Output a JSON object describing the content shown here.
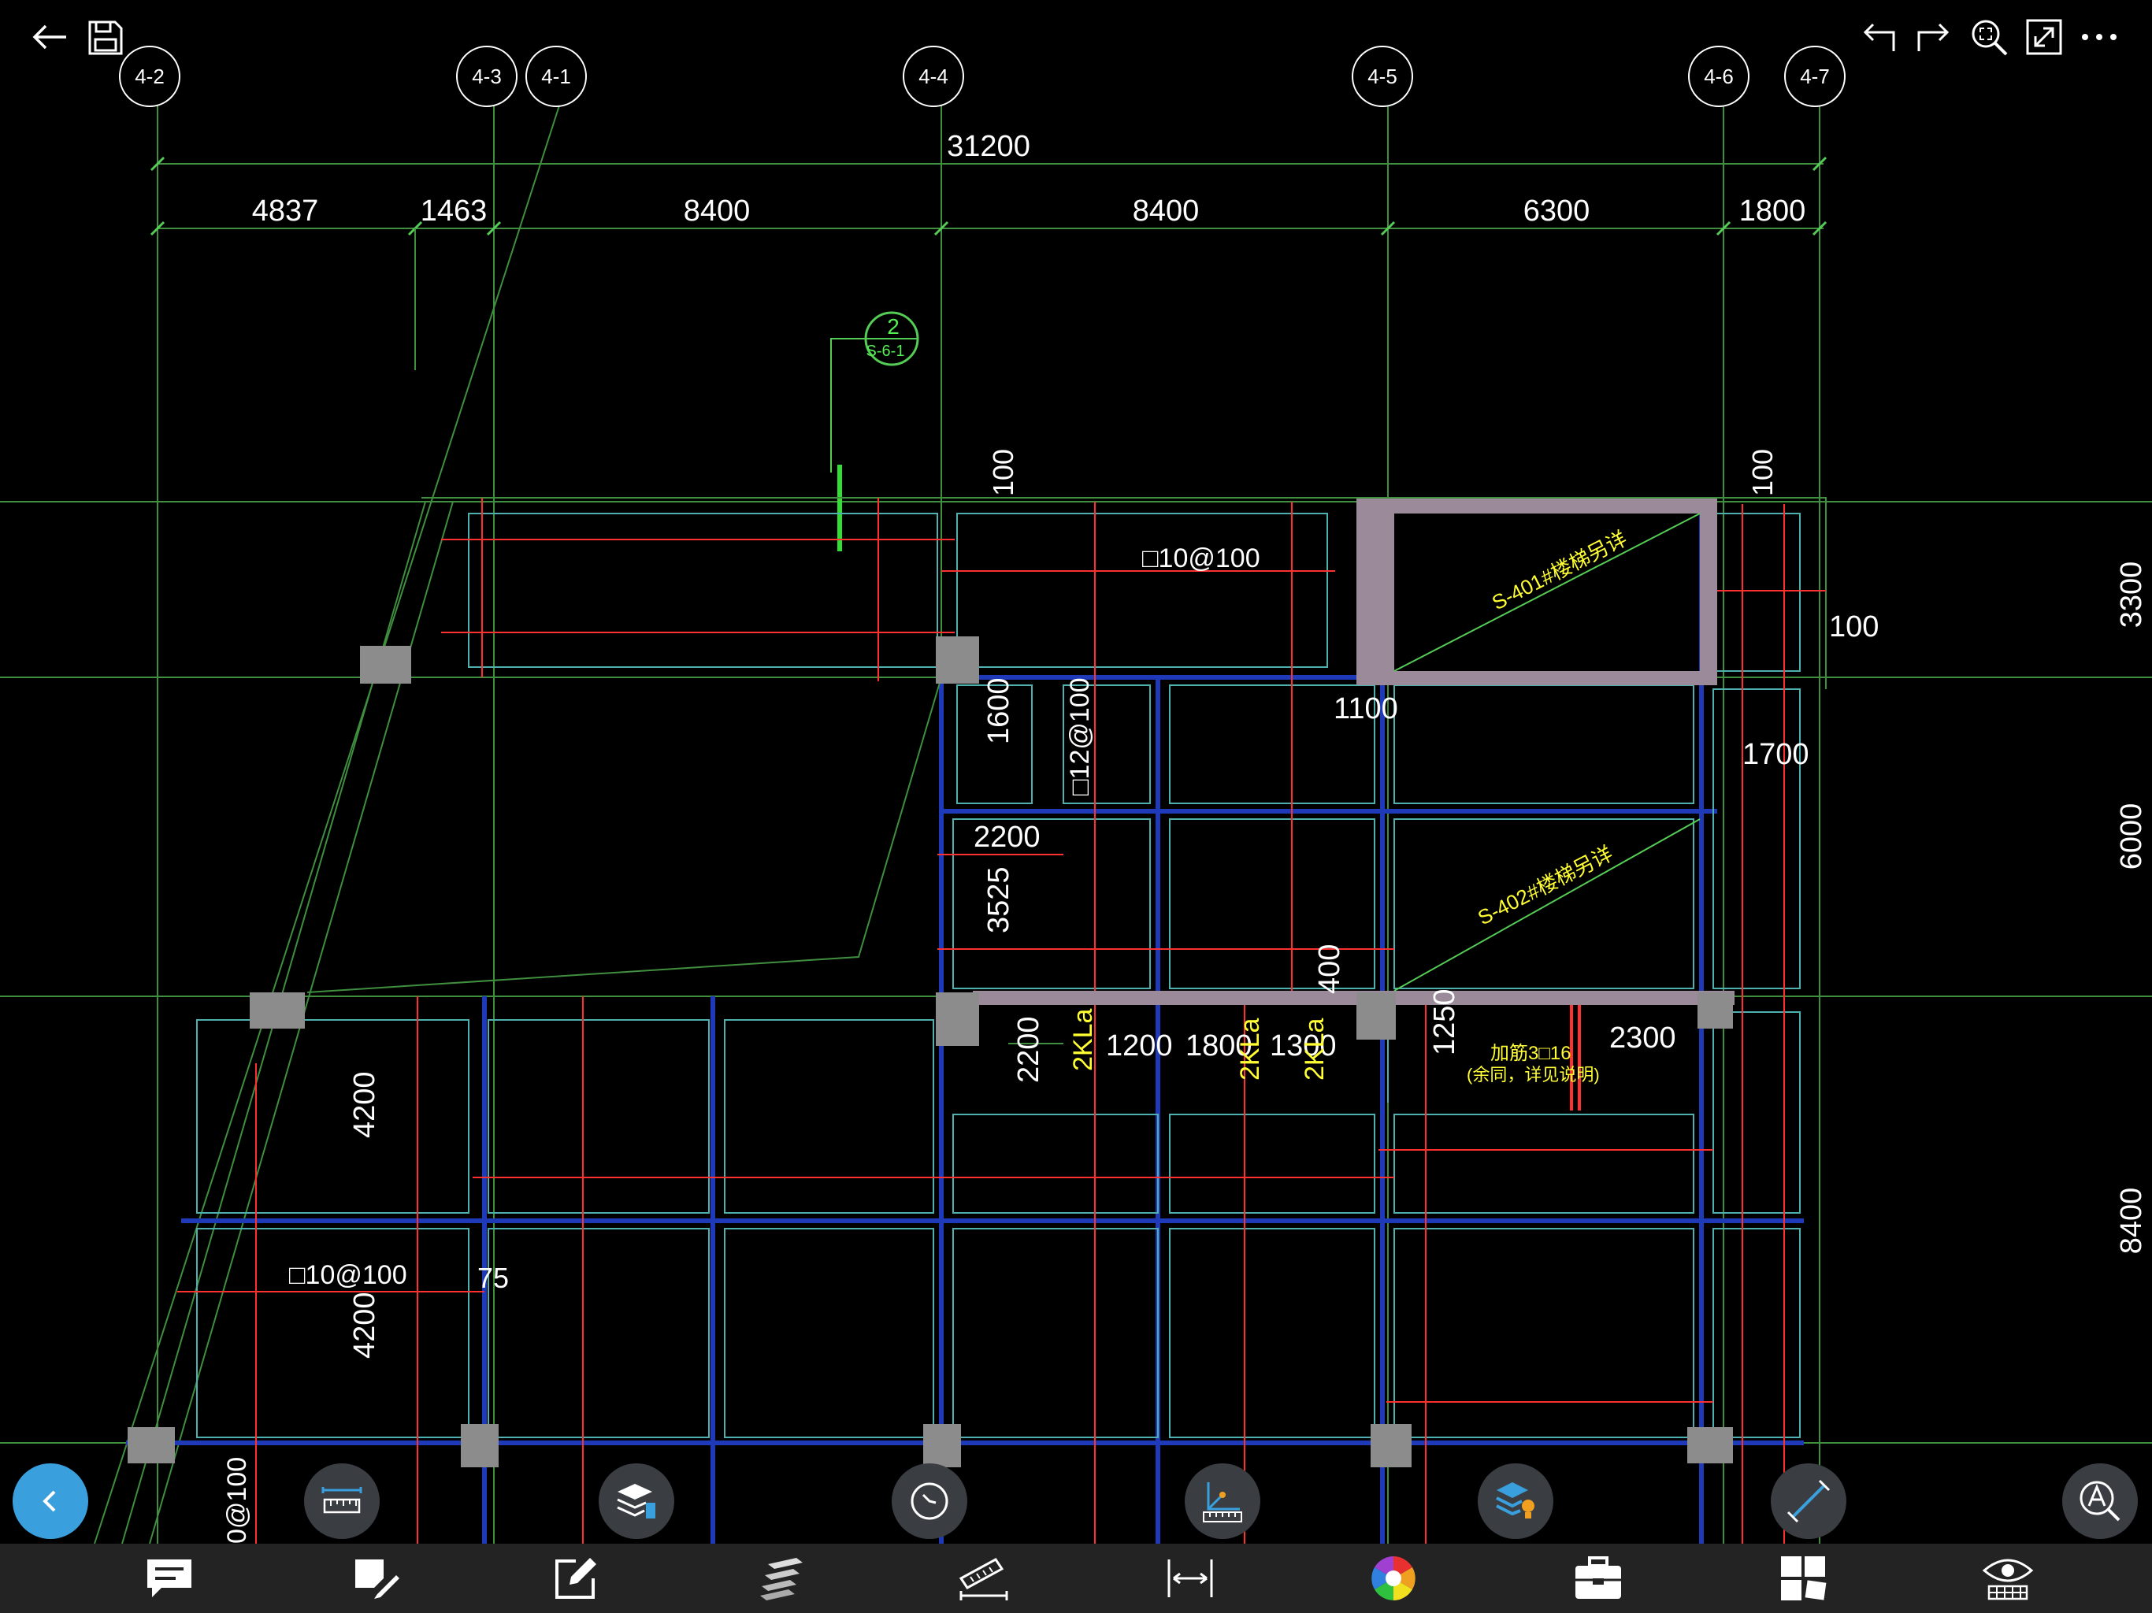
{
  "header": {
    "back_icon": "arrow-left-icon",
    "save_icon": "save-icon",
    "undo_icon": "undo-icon",
    "redo_icon": "redo-icon",
    "zoom_fit_icon": "zoom-fit-icon",
    "fullscreen_icon": "fullscreen-icon",
    "more_icon": "more-icon"
  },
  "axes": [
    "4-2",
    "4-3",
    "4-1",
    "4-4",
    "4-5",
    "4-6",
    "4-7"
  ],
  "dimensions": {
    "total": "31200",
    "segments": [
      "4837",
      "1463",
      "8400",
      "8400",
      "6300",
      "1800"
    ],
    "right_side": [
      "3300",
      "6000",
      "8400"
    ]
  },
  "section_marker": {
    "number": "2",
    "sheet": "S-6-1"
  },
  "drawing_text": {
    "rebar_1": "□10@100",
    "rebar_2": "□10@100",
    "rebar_3": "□12@100",
    "rebar_4": "0@100",
    "d100_a": "100",
    "d100_b": "100",
    "d100_c": "100",
    "d1100": "1100",
    "d1700": "1700",
    "d1600": "1600",
    "d2200_a": "2200",
    "d3525": "3525",
    "d400": "400",
    "d2200_b": "2200",
    "d1200": "1200",
    "d1800": "1800",
    "d1300": "1300",
    "d1250": "1250",
    "d2300": "2300",
    "d4200_a": "4200",
    "d4200_b": "4200",
    "d75": "75",
    "kla_1": "2KLa",
    "kla_2": "2KLa",
    "kla_3": "2KLa",
    "stair_1": "S-401#楼梯另详",
    "stair_2": "S-402#楼梯另详",
    "note_1": "加筋3□16",
    "note_2": "(余同，详见说明)"
  },
  "floating_tools": [
    {
      "name": "back-circle-button",
      "icon": "chevron-left-icon"
    },
    {
      "name": "measure-button",
      "icon": "ruler-icon"
    },
    {
      "name": "layers-button",
      "icon": "layers-icon"
    },
    {
      "name": "compass-button",
      "icon": "compass-icon"
    },
    {
      "name": "coordinate-button",
      "icon": "coordinate-icon"
    },
    {
      "name": "layer-manager-button",
      "icon": "layer-bulb-icon"
    },
    {
      "name": "align-button",
      "icon": "diagonal-line-icon"
    },
    {
      "name": "text-search-button",
      "icon": "text-search-icon"
    }
  ],
  "bottom_tools": [
    {
      "name": "comment-tool",
      "icon": "comment-icon"
    },
    {
      "name": "markup-tool",
      "icon": "pen-shape-icon"
    },
    {
      "name": "edit-tool",
      "icon": "edit-icon"
    },
    {
      "name": "layers-tool",
      "icon": "layer-stack-icon"
    },
    {
      "name": "ruler-tool",
      "icon": "ruler-measure-icon"
    },
    {
      "name": "dimension-tool",
      "icon": "dimension-icon"
    },
    {
      "name": "color-tool",
      "icon": "color-wheel-icon"
    },
    {
      "name": "toolbox-tool",
      "icon": "toolbox-icon"
    },
    {
      "name": "layout-tool",
      "icon": "layout-icon"
    },
    {
      "name": "view-tool",
      "icon": "eye-icon"
    }
  ],
  "colors": {
    "background": "#000000",
    "grid_line": "#3f8f3f",
    "dim_line": "#55cc55",
    "red_line": "#ff3030",
    "wall": "#1f3ab8",
    "cyan": "#4fb0b0",
    "column": "#8c8c8c",
    "stair_wall": "#9a8a9a",
    "yellow_text": "#ffff33",
    "blue_button": "#3aa0dd"
  }
}
